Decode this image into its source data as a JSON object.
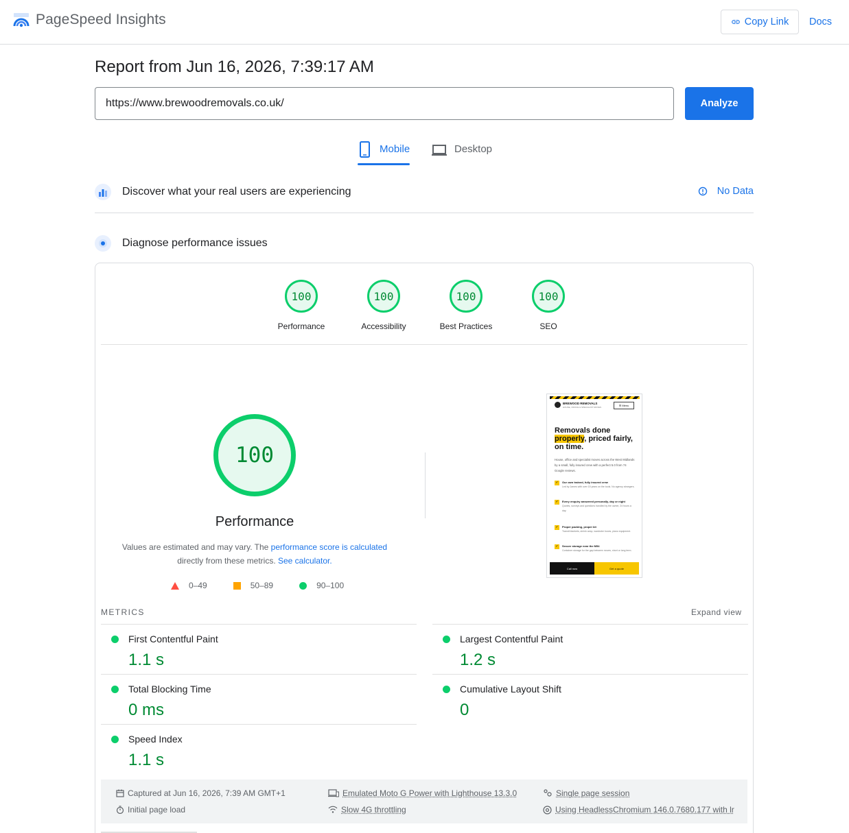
{
  "header": {
    "app_title": "PageSpeed Insights",
    "copy_link_label": "Copy Link",
    "docs_label": "Docs"
  },
  "report": {
    "title": "Report from Jun 16, 2026, 7:39:17 AM",
    "url_value": "https://www.brewoodremovals.co.uk/",
    "analyze_label": "Analyze"
  },
  "tabs": [
    {
      "label": "Mobile",
      "active": true
    },
    {
      "label": "Desktop",
      "active": false
    }
  ],
  "field_data": {
    "title": "Discover what your real users are experiencing",
    "status": "No Data"
  },
  "diagnose": {
    "title": "Diagnose performance issues"
  },
  "categories": [
    {
      "label": "Performance",
      "score": "100"
    },
    {
      "label": "Accessibility",
      "score": "100"
    },
    {
      "label": "Best Practices",
      "score": "100"
    },
    {
      "label": "SEO",
      "score": "100"
    }
  ],
  "performance": {
    "score": "100",
    "title": "Performance",
    "note_pre": "Values are estimated and may vary. The ",
    "note_link1": "performance score is calculated",
    "note_mid": " directly from these metrics. ",
    "note_link2": "See calculator.",
    "legend": [
      {
        "range": "0–49",
        "color": "#ff4e42"
      },
      {
        "range": "50–89",
        "color": "#ffa400"
      },
      {
        "range": "90–100",
        "color": "#0cce6b"
      }
    ]
  },
  "thumbnail": {
    "brand": "BREWOOD REMOVALS",
    "brand_sub": "HOUSE, OFFICE & SPECIALIST MOVES",
    "menu": "☰ Menu",
    "headline_1": "Removals done",
    "headline_highlight": "properly",
    "headline_2": ", priced fairly, on time.",
    "intro": "House, office and specialist moves across the West Midlands by a small, fully insured crew with a perfect 5.0 from 74 Google reviews.",
    "bullets": [
      {
        "title": "Our own trained, fully insured crew",
        "desc": "Led by James with over 15 years on the tools. No agency strangers."
      },
      {
        "title": "Every enquiry answered personally, day or night",
        "desc": "Quotes, surveys and questions handled by the owner, 24 hours a day."
      },
      {
        "title": "Proper packing, proper kit",
        "desc": "Transit blankets, shrink wrap, wardrobe boxes, piano equipment."
      },
      {
        "title": "Secure storage near the M54",
        "desc": "Container storage for the gap between moves, short or long term."
      }
    ],
    "btn_call": "Call now",
    "btn_quote": "Get a quote"
  },
  "metrics": {
    "heading": "METRICS",
    "expand_label": "Expand view",
    "items": [
      {
        "name": "First Contentful Paint",
        "value": "1.1 s"
      },
      {
        "name": "Largest Contentful Paint",
        "value": "1.2 s"
      },
      {
        "name": "Total Blocking Time",
        "value": "0 ms"
      },
      {
        "name": "Cumulative Layout Shift",
        "value": "0"
      },
      {
        "name": "Speed Index",
        "value": "1.1 s"
      }
    ]
  },
  "run_info": {
    "captured": "Captured at Jun 16, 2026, 7:39 AM GMT+1",
    "initial_load": "Initial page load",
    "device": "Emulated Moto G Power with Lighthouse 13.3.0",
    "throttling": "Slow 4G throttling",
    "session": "Single page session",
    "browser": "Using HeadlessChromium 146.0.7680.177 with lr"
  },
  "colors": {
    "accent": "#1a73e8",
    "pass": "#0cce6b",
    "pass_text": "#008a33"
  }
}
